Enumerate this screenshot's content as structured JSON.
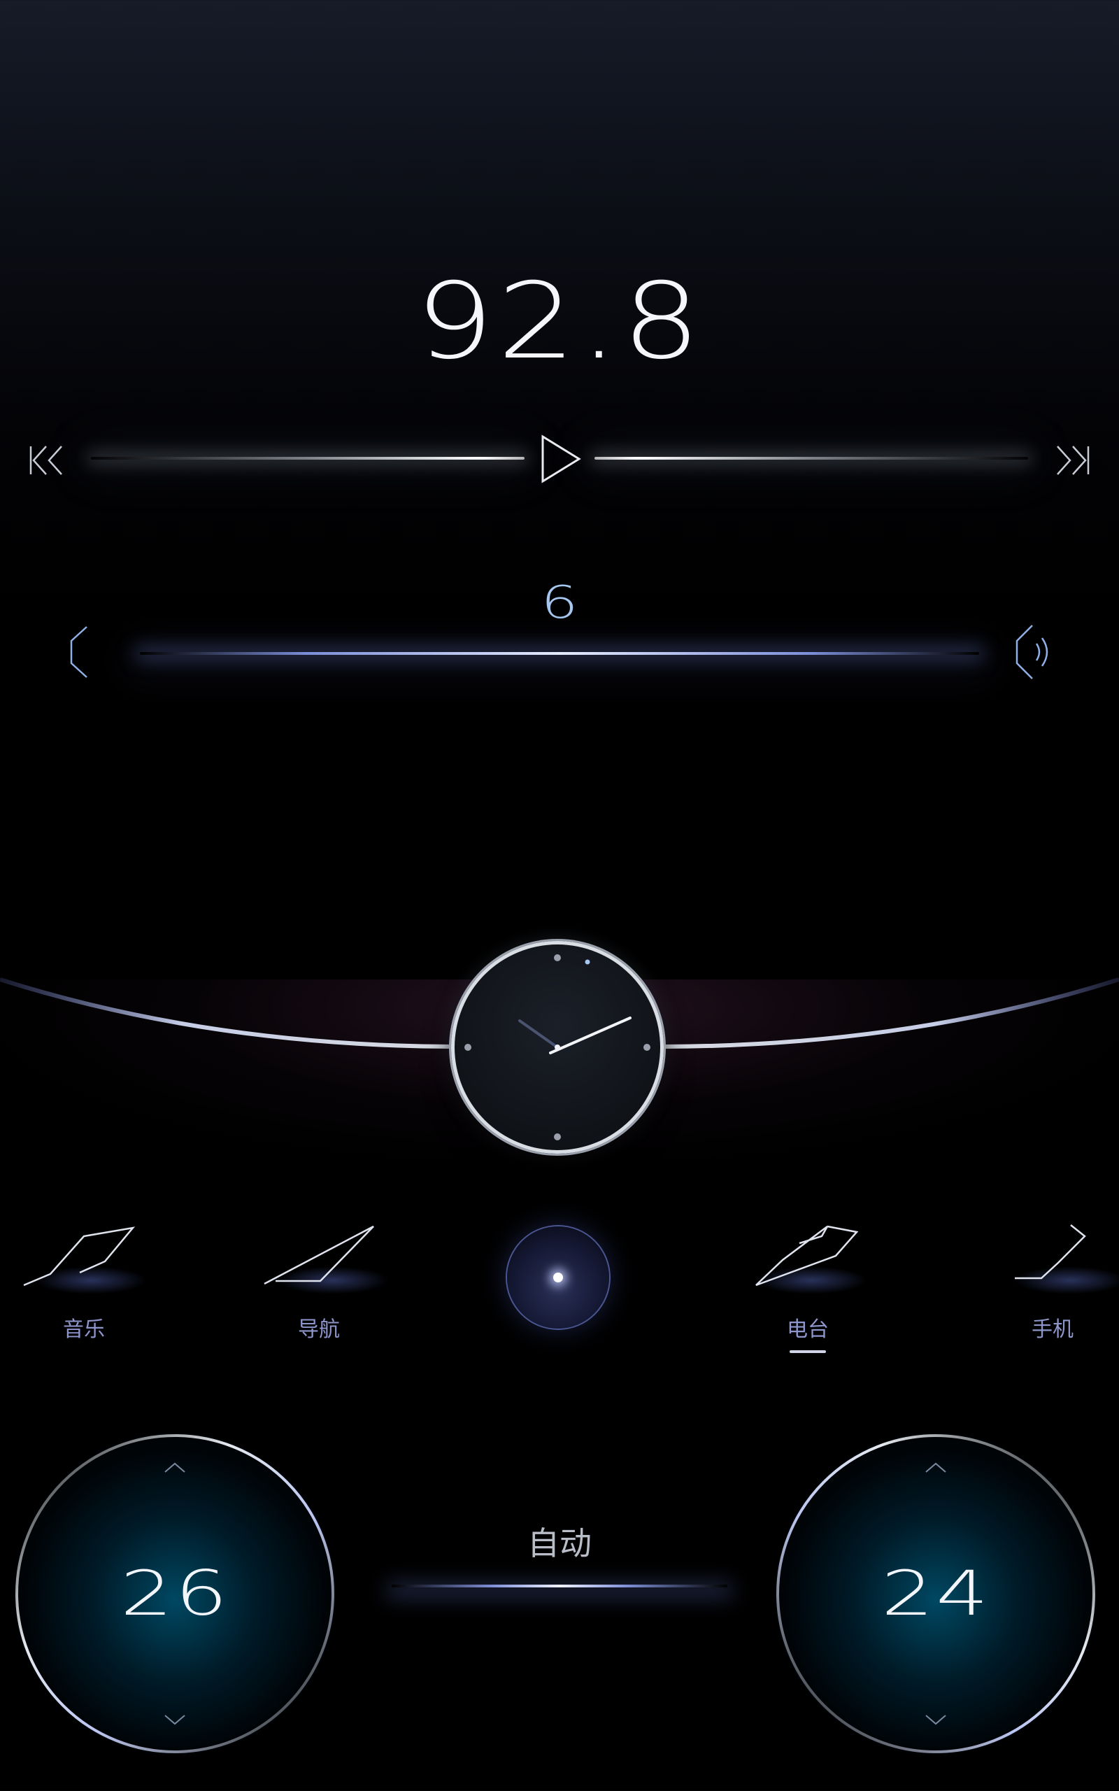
{
  "radio": {
    "frequency": "92.8"
  },
  "volume": {
    "level": "6"
  },
  "nav": {
    "items": [
      {
        "label": "音乐",
        "icon": "music-icon"
      },
      {
        "label": "导航",
        "icon": "navigation-icon"
      },
      {
        "label": "电台",
        "icon": "radio-icon",
        "active": true
      },
      {
        "label": "手机",
        "icon": "phone-icon"
      }
    ]
  },
  "climate": {
    "left_temp": "26",
    "right_temp": "24",
    "mode": "自动"
  },
  "colors": {
    "accent": "#8f96cc",
    "temp_glow": "#00708f",
    "volume_line": "#7c8ed8"
  }
}
